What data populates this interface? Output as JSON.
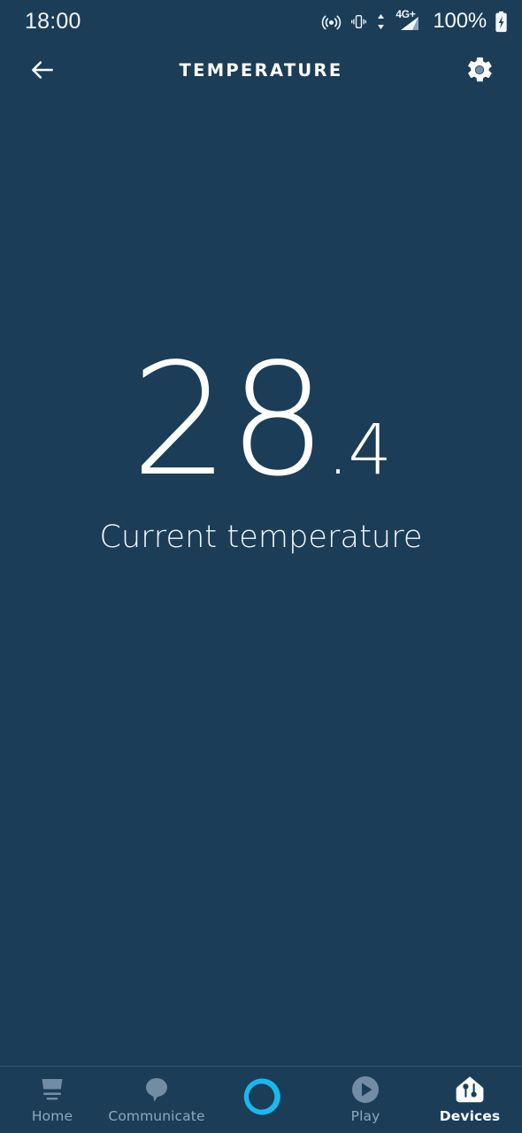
{
  "theme": {
    "background": "#1b3d58",
    "nav_divider": "#2b5270",
    "text_primary": "#ffffff",
    "text_muted": "#8fa8bb",
    "accent_alexa": "#19b9f0",
    "icon_inactive": "#728da3"
  },
  "status_bar": {
    "time": "18:00",
    "battery_percent": "100%",
    "network_label": "4G+",
    "icons": [
      {
        "name": "hotspot-icon"
      },
      {
        "name": "vibrate-icon"
      },
      {
        "name": "data-transfer-icon"
      },
      {
        "name": "cellular-signal-icon"
      },
      {
        "name": "battery-charging-icon"
      }
    ]
  },
  "app_bar": {
    "back_label": "Back",
    "title": "TEMPERATURE",
    "settings_label": "Settings"
  },
  "main": {
    "temperature_integer": "28",
    "temperature_decimal": ".4",
    "temperature_value": "28.4",
    "caption": "Current temperature"
  },
  "bottom_nav": {
    "items": [
      {
        "label": "Home",
        "icon": "home-icon",
        "active": false
      },
      {
        "label": "Communicate",
        "icon": "chat-bubble-icon",
        "active": false
      },
      {
        "label": "",
        "icon": "alexa-ring-icon",
        "active": false
      },
      {
        "label": "Play",
        "icon": "play-circle-icon",
        "active": false
      },
      {
        "label": "Devices",
        "icon": "devices-home-icon",
        "active": true
      }
    ]
  }
}
